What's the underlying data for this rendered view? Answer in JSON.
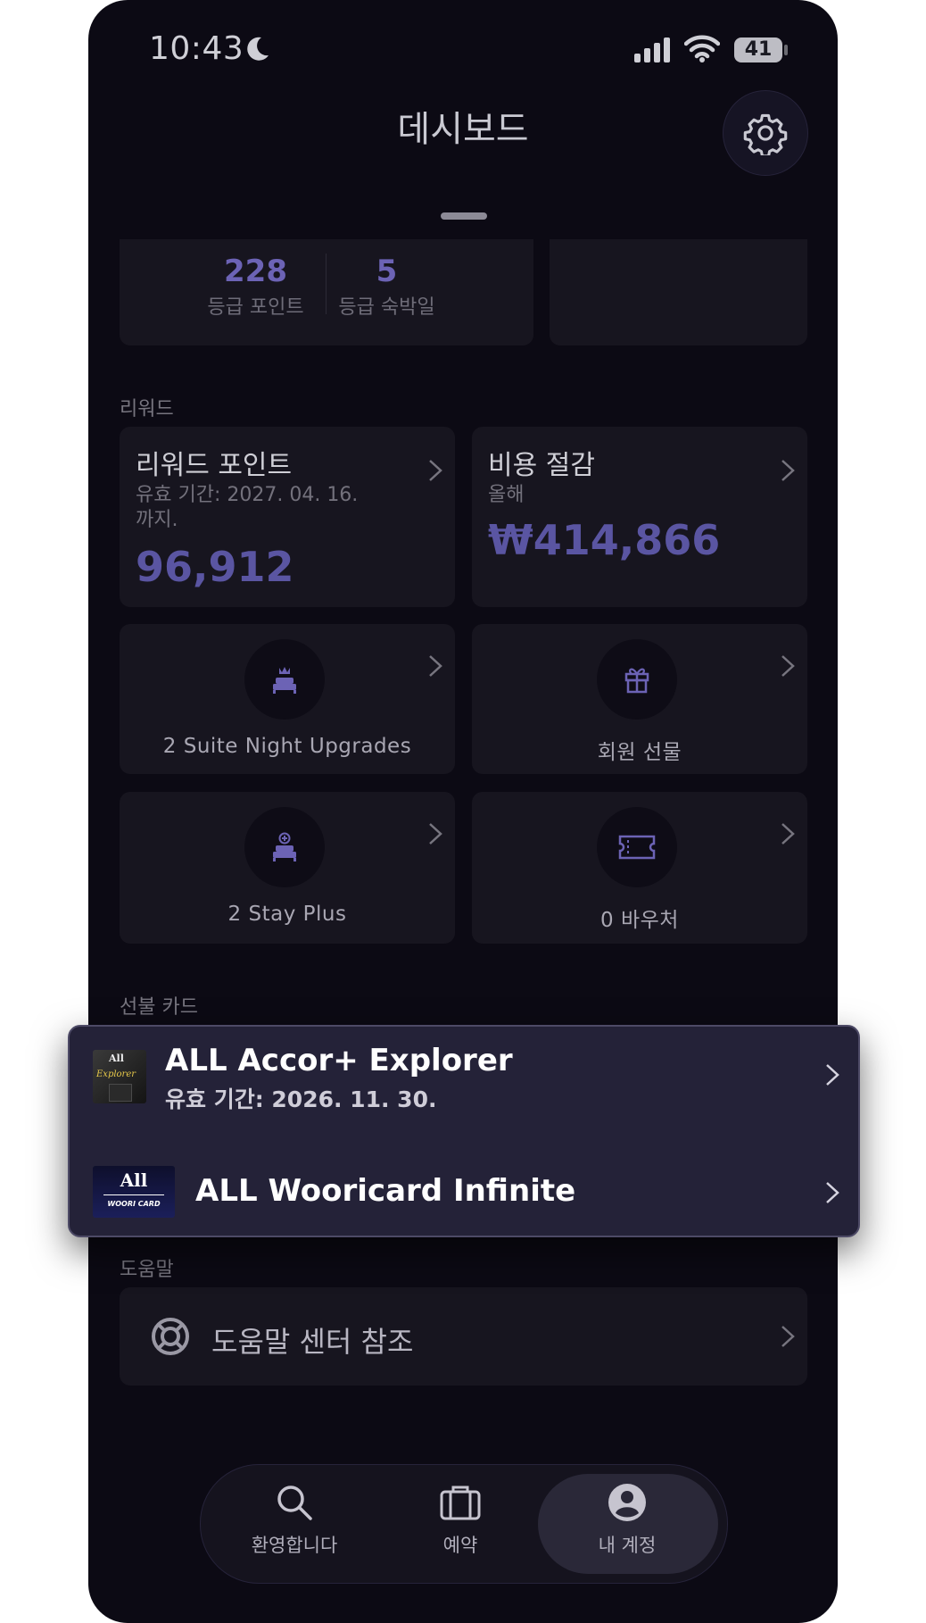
{
  "status_bar": {
    "time": "10:43",
    "battery": "41"
  },
  "header": {
    "title": "데시보드"
  },
  "status_stats": [
    {
      "value": "228",
      "label": "등급 포인트"
    },
    {
      "value": "5",
      "label": "등급 숙박일"
    }
  ],
  "rewards": {
    "section_label": "리워드",
    "points": {
      "title": "리워드 포인트",
      "validity": "유효 기간: 2027. 04. 16.",
      "validity_suffix": "까지.",
      "value": "96,912"
    },
    "savings": {
      "title": "비용 절감",
      "period": "올해",
      "value": "₩414,866"
    },
    "tiles": [
      {
        "label": "2 Suite Night Upgrades",
        "icon": "bed-crown-icon"
      },
      {
        "label": "회원 선물",
        "icon": "gift-icon"
      },
      {
        "label": "2 Stay Plus",
        "icon": "bed-plus-icon"
      },
      {
        "label": "0 바우처",
        "icon": "ticket-icon"
      }
    ]
  },
  "prepaid": {
    "section_label": "선불 카드",
    "cards": [
      {
        "title": "ALL Accor+ Explorer",
        "validity": "유효 기간: 2026. 11. 30.",
        "thumb_text": "All",
        "thumb_script": "Explorer"
      },
      {
        "title": "ALL Wooricard Infinite",
        "thumb_text": "All",
        "thumb_sub": "WOORI CARD"
      }
    ]
  },
  "help": {
    "section_label": "도움말",
    "item_label": "도움말 센터 참조"
  },
  "tabbar": {
    "tabs": [
      {
        "label": "환영합니다",
        "icon": "search-icon"
      },
      {
        "label": "예약",
        "icon": "briefcase-icon"
      },
      {
        "label": "내 계정",
        "icon": "account-icon",
        "selected": true
      }
    ]
  },
  "colors": {
    "accent": "#5a55a2",
    "background": "#0c0a14",
    "card": "#17151f"
  }
}
